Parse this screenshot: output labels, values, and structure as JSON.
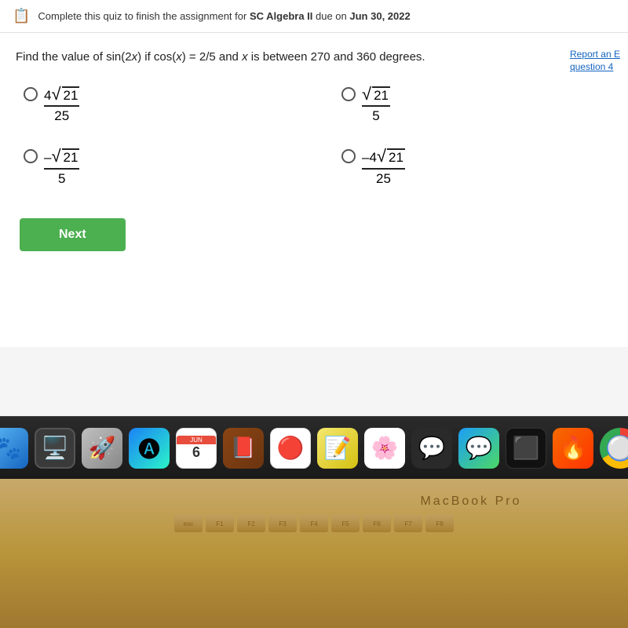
{
  "banner": {
    "icon": "📋",
    "text_prefix": "Complete this quiz to finish the assignment for ",
    "course": "SC Algebra II",
    "text_mid": " due on ",
    "due_date": "Jun 30, 2022"
  },
  "question": {
    "text": "Find the value of sin(2x) if cos(x) = 2/5 and x is between 270 and 360 degrees.",
    "report_link": "Report an E",
    "report_sub": "question 4"
  },
  "options": [
    {
      "id": "A",
      "numerator": "4√21",
      "denominator": "25",
      "negative": false
    },
    {
      "id": "B",
      "numerator": "√21",
      "denominator": "5",
      "negative": false
    },
    {
      "id": "C",
      "numerator": "–√21",
      "denominator": "5",
      "negative": true
    },
    {
      "id": "D",
      "numerator": "–4√21",
      "denominator": "25",
      "negative": true
    }
  ],
  "next_button": "Next",
  "dock": {
    "month": "JUN",
    "day": "6"
  },
  "macbook_label": "MacBook Pro"
}
